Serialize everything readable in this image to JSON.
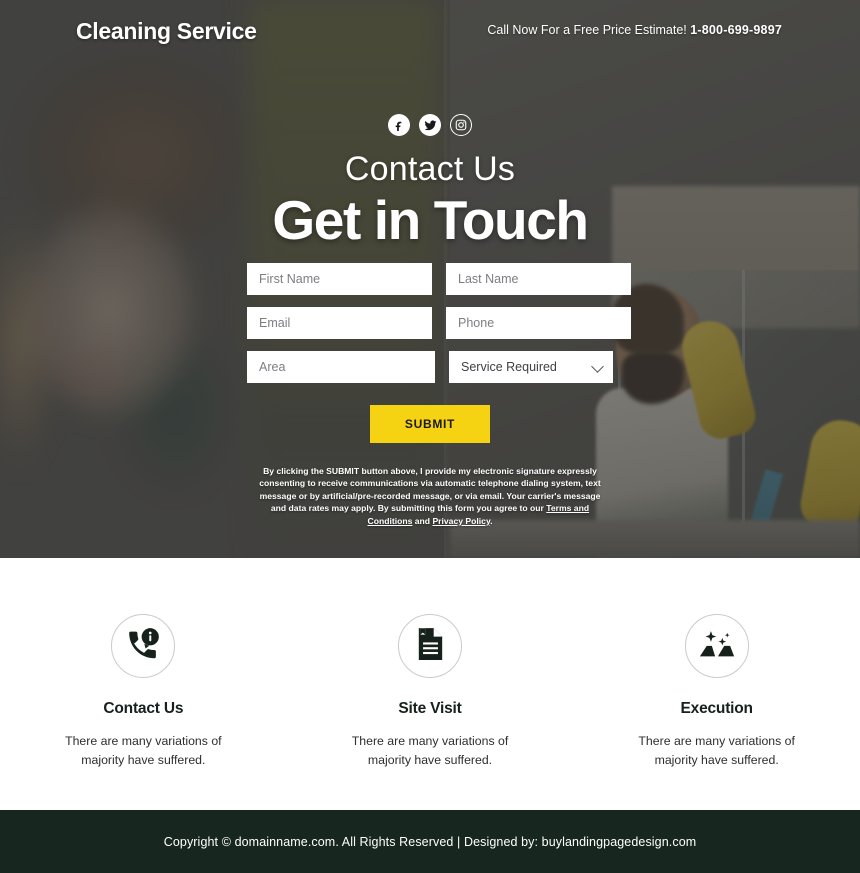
{
  "header": {
    "brand": "Cleaning Service",
    "call_prefix": "Call Now For a Free Price Estimate!",
    "phone": "1-800-699-9897"
  },
  "social": [
    {
      "name": "facebook",
      "icon": "facebook-icon",
      "style": "filled"
    },
    {
      "name": "twitter",
      "icon": "twitter-icon",
      "style": "filled"
    },
    {
      "name": "instagram",
      "icon": "instagram-icon",
      "style": "outline"
    }
  ],
  "hero": {
    "kicker": "Contact Us",
    "headline": "Get in Touch"
  },
  "form": {
    "first_name_placeholder": "First Name",
    "last_name_placeholder": "Last Name",
    "email_placeholder": "Email",
    "phone_placeholder": "Phone",
    "area_placeholder": "Area",
    "service_selected": "Service Required",
    "submit_label": "SUBMIT",
    "disclaimer_part1": "By clicking the SUBMIT button above, I provide my electronic signature expressly consenting to receive communications via automatic telephone dialing system, text message or by artificial/pre-recorded message, or via email. Your carrier's message and data rates may apply. By submitting this form you agree to our ",
    "disclaimer_link1": "Terms and Conditions",
    "disclaimer_mid": " and ",
    "disclaimer_link2": "Privacy Policy",
    "disclaimer_end": "."
  },
  "features": [
    {
      "icon": "phone-info-icon",
      "title": "Contact Us",
      "desc": "There are many variations of majority have suffered."
    },
    {
      "icon": "document-icon",
      "title": "Site Visit",
      "desc": "There are many variations of majority have suffered."
    },
    {
      "icon": "sparkle-clean-icon",
      "title": "Execution",
      "desc": "There are many variations of majority have suffered."
    }
  ],
  "footer": {
    "text": "Copyright © domainname.com. All Rights Reserved | Designed by: buylandingpagedesign.com"
  },
  "colors": {
    "accent_yellow": "#F5D312",
    "footer_green": "#17271f",
    "hero_overlay": "rgba(45,45,45,0.55)",
    "icon_dark": "#16211b"
  }
}
